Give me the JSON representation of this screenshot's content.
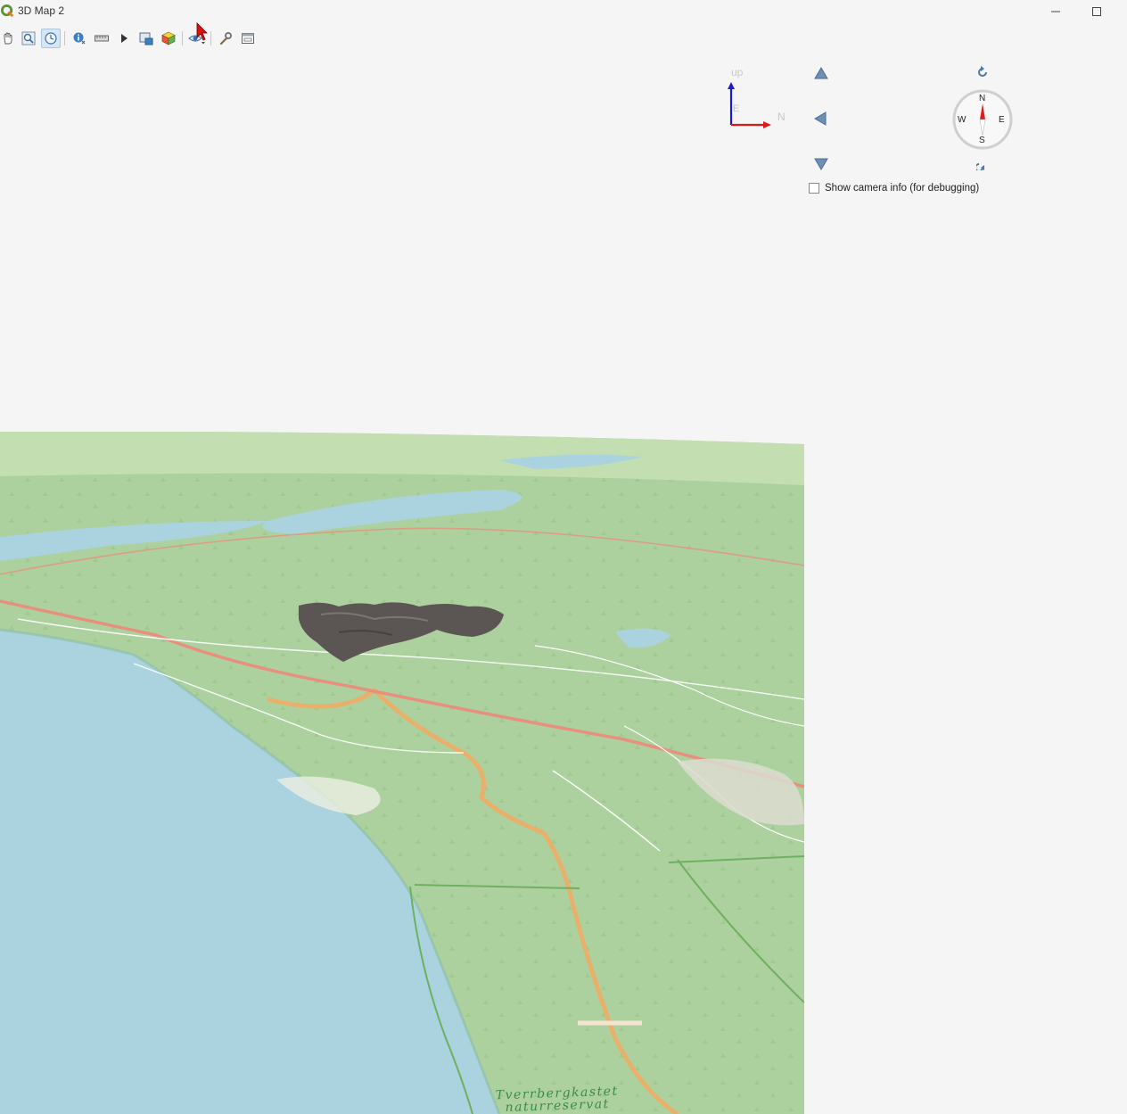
{
  "window": {
    "title": "3D Map 2",
    "app_icon": "qgis-logo-icon",
    "controls": [
      "minimize-icon",
      "maximize-icon"
    ]
  },
  "toolbar": {
    "buttons": [
      {
        "name": "pan-tool",
        "icon": "hand-icon",
        "active": false
      },
      {
        "name": "zoom-full",
        "icon": "zoom-full-icon",
        "active": false
      },
      {
        "name": "camera-control",
        "icon": "camera-orbit-icon",
        "active": true
      },
      {
        "name": "identify",
        "icon": "identify-icon",
        "active": false
      },
      {
        "name": "measure",
        "icon": "ruler-icon",
        "active": false
      },
      {
        "name": "animation",
        "icon": "play-icon",
        "active": false
      },
      {
        "name": "save-image",
        "icon": "save-image-icon",
        "active": false
      },
      {
        "name": "export-3d",
        "icon": "cube-icon",
        "active": false
      },
      {
        "name": "camera-settings",
        "icon": "eye-dropdown-icon",
        "active": false
      },
      {
        "name": "configure",
        "icon": "wrench-icon",
        "active": false
      },
      {
        "name": "dock-window",
        "icon": "dock-icon",
        "active": false
      }
    ]
  },
  "axis_widget": {
    "up_label": "up",
    "north_label": "N",
    "east_label": "E",
    "colors": {
      "up": "#1a1ad8",
      "north": "#d81a1a"
    }
  },
  "navigation": {
    "arrows": [
      "arrow-up-icon",
      "arrow-left-icon",
      "arrow-down-icon"
    ],
    "rotate": [
      "rotate-ccw-icon",
      "rotate-cw-icon"
    ]
  },
  "compass": {
    "n": "N",
    "s": "S",
    "e": "E",
    "w": "W"
  },
  "camera_info": {
    "label": "Show camera info (for debugging)",
    "checked": false
  },
  "map": {
    "place_label_1": "Tverrbergkastet",
    "place_label_2": "naturreservat",
    "colors": {
      "land": "#a9d49a",
      "water": "#aad3df",
      "road": "#e8b06a",
      "raster": "#5a5553"
    }
  }
}
